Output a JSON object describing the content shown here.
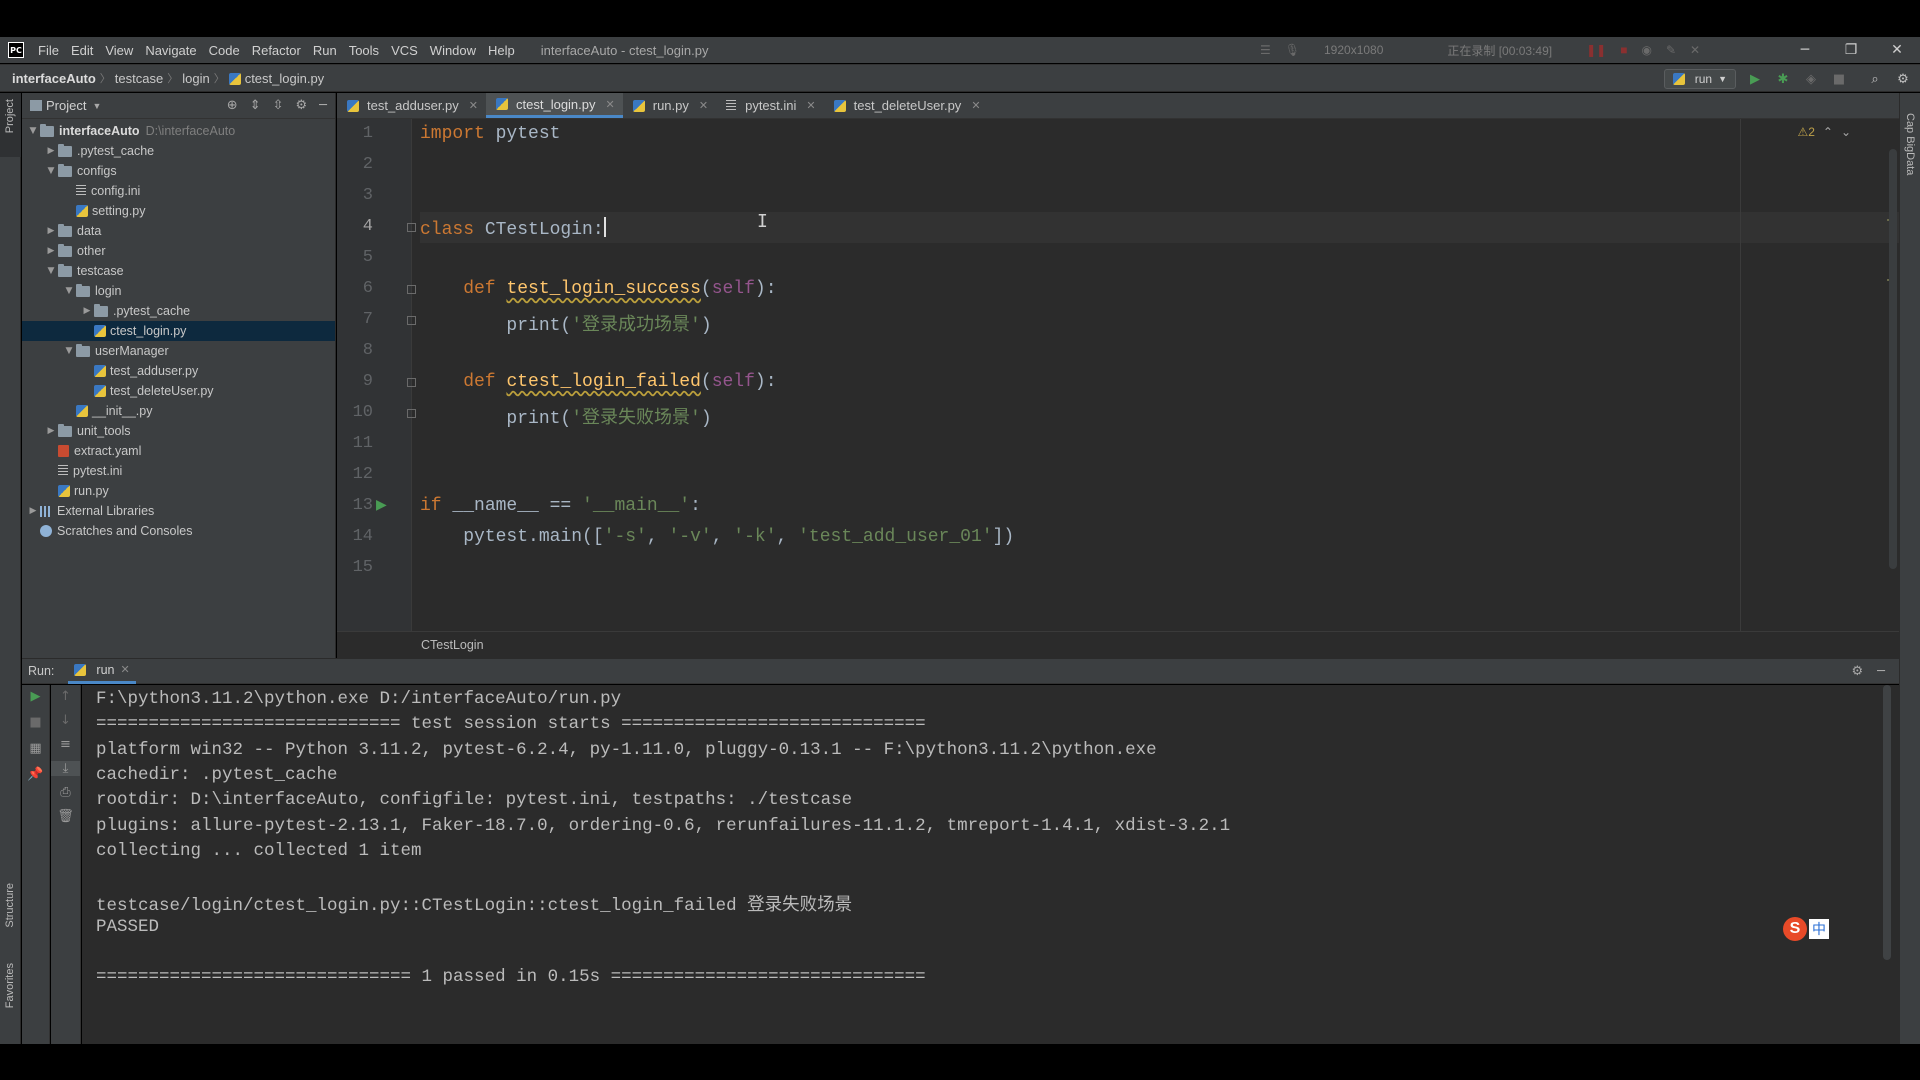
{
  "menubar": {
    "logo": "PC",
    "items": [
      "File",
      "Edit",
      "View",
      "Navigate",
      "Code",
      "Refactor",
      "Run",
      "Tools",
      "VCS",
      "Window",
      "Help"
    ],
    "window_title": "interfaceAuto - ctest_login.py",
    "recorder": {
      "resolution": "1920x1080",
      "status": "正在录制 [00:03:49]"
    }
  },
  "navbar": {
    "crumbs": [
      "interfaceAuto",
      "testcase",
      "login",
      "ctest_login.py"
    ],
    "run_config": "run"
  },
  "project_panel": {
    "title": "Project",
    "tree": [
      {
        "label": "interfaceAuto",
        "hint": "D:\\interfaceAuto",
        "chevron": "▼",
        "icon": "folder",
        "bold": true
      },
      {
        "label": ".pytest_cache",
        "chevron": "▶",
        "icon": "folder"
      },
      {
        "label": "configs",
        "chevron": "▼",
        "icon": "folder"
      },
      {
        "label": "config.ini",
        "icon": "ini"
      },
      {
        "label": "setting.py",
        "icon": "py"
      },
      {
        "label": "data",
        "chevron": "▶",
        "icon": "folder"
      },
      {
        "label": "other",
        "chevron": "▶",
        "icon": "folder"
      },
      {
        "label": "testcase",
        "chevron": "▼",
        "icon": "folder"
      },
      {
        "label": "login",
        "chevron": "▼",
        "icon": "folder"
      },
      {
        "label": ".pytest_cache",
        "chevron": "▶",
        "icon": "folder"
      },
      {
        "label": "ctest_login.py",
        "icon": "py",
        "selected": true
      },
      {
        "label": "userManager",
        "chevron": "▼",
        "icon": "folder"
      },
      {
        "label": "test_adduser.py",
        "icon": "py"
      },
      {
        "label": "test_deleteUser.py",
        "icon": "py"
      },
      {
        "label": "__init__.py",
        "icon": "py"
      },
      {
        "label": "unit_tools",
        "chevron": "▶",
        "icon": "folder"
      },
      {
        "label": "extract.yaml",
        "icon": "yaml"
      },
      {
        "label": "pytest.ini",
        "icon": "ini"
      },
      {
        "label": "run.py",
        "icon": "py"
      },
      {
        "label": "External Libraries",
        "chevron": "▶",
        "icon": "lib"
      },
      {
        "label": "Scratches and Consoles",
        "icon": "scratch"
      }
    ]
  },
  "left_strip": {
    "project": "Project",
    "structure": "Structure",
    "favorites": "Favorites"
  },
  "right_strip": {
    "label": "Cap BigData"
  },
  "editor_tabs": [
    {
      "label": "test_adduser.py",
      "icon": "py"
    },
    {
      "label": "ctest_login.py",
      "icon": "py",
      "active": true
    },
    {
      "label": "run.py",
      "icon": "py"
    },
    {
      "label": "pytest.ini",
      "icon": "ini"
    },
    {
      "label": "test_deleteUser.py",
      "icon": "py"
    }
  ],
  "editor": {
    "warnings": "⚠2",
    "current_line": 4,
    "line_numbers": [
      "1",
      "2",
      "3",
      "4",
      "5",
      "6",
      "7",
      "8",
      "9",
      "10",
      "11",
      "12",
      "13",
      "14",
      "15"
    ],
    "lines": [
      [
        {
          "t": "import",
          "c": "kw"
        },
        {
          "t": " pytest",
          "c": ""
        }
      ],
      [],
      [],
      [
        {
          "t": "class",
          "c": "kw"
        },
        {
          "t": " CTestLogin:",
          "c": ""
        }
      ],
      [],
      [
        {
          "t": "    def",
          "c": "kw"
        },
        {
          "t": " ",
          "c": ""
        },
        {
          "t": "test_login_success",
          "c": "fn"
        },
        {
          "t": "(",
          "c": ""
        },
        {
          "t": "self",
          "c": "self"
        },
        {
          "t": "):",
          "c": ""
        }
      ],
      [
        {
          "t": "        print(",
          "c": ""
        },
        {
          "t": "'登录成功场景'",
          "c": "str"
        },
        {
          "t": ")",
          "c": ""
        }
      ],
      [],
      [
        {
          "t": "    def",
          "c": "kw"
        },
        {
          "t": " ",
          "c": ""
        },
        {
          "t": "ctest_login_failed",
          "c": "fn"
        },
        {
          "t": "(",
          "c": ""
        },
        {
          "t": "self",
          "c": "self"
        },
        {
          "t": "):",
          "c": ""
        }
      ],
      [
        {
          "t": "        print(",
          "c": ""
        },
        {
          "t": "'登录失败场景'",
          "c": "str"
        },
        {
          "t": ")",
          "c": ""
        }
      ],
      [],
      [],
      [
        {
          "t": "if",
          "c": "kw"
        },
        {
          "t": " __name__ == ",
          "c": ""
        },
        {
          "t": "'__main__'",
          "c": "str"
        },
        {
          "t": ":",
          "c": ""
        }
      ],
      [
        {
          "t": "    pytest.main([",
          "c": ""
        },
        {
          "t": "'-s'",
          "c": "str"
        },
        {
          "t": ", ",
          "c": ""
        },
        {
          "t": "'-v'",
          "c": "str"
        },
        {
          "t": ", ",
          "c": ""
        },
        {
          "t": "'-k'",
          "c": "str"
        },
        {
          "t": ", ",
          "c": ""
        },
        {
          "t": "'test_add_user_01'",
          "c": "str"
        },
        {
          "t": "])",
          "c": ""
        }
      ],
      []
    ],
    "breadcrumb": "CTestLogin"
  },
  "run_panel": {
    "label": "Run:",
    "tab": "run",
    "console_lines": [
      "F:\\python3.11.2\\python.exe D:/interfaceAuto/run.py",
      "============================= test session starts =============================",
      "platform win32 -- Python 3.11.2, pytest-6.2.4, py-1.11.0, pluggy-0.13.1 -- F:\\python3.11.2\\python.exe",
      "cachedir: .pytest_cache",
      "rootdir: D:\\interfaceAuto, configfile: pytest.ini, testpaths: ./testcase",
      "plugins: allure-pytest-2.13.1, Faker-18.7.0, ordering-0.6, rerunfailures-11.1.2, tmreport-1.4.1, xdist-3.2.1",
      "collecting ... collected 1 item",
      "",
      "testcase/login/ctest_login.py::CTestLogin::ctest_login_failed 登录失败场景",
      "PASSED",
      "",
      "============================== 1 passed in 0.15s =============================="
    ]
  },
  "ime": {
    "logo": "S",
    "mode": "中"
  }
}
